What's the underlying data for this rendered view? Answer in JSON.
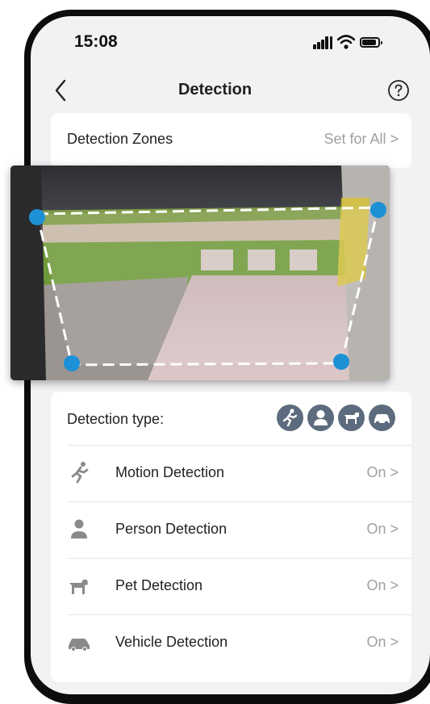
{
  "status_bar": {
    "time": "15:08"
  },
  "nav": {
    "title": "Detection"
  },
  "detection_zones": {
    "label": "Detection Zones",
    "link": "Set for All >"
  },
  "detection_type": {
    "label": "Detection type:",
    "rows": [
      {
        "label": "Motion Detection",
        "value": "On >",
        "icon": "running-person-icon"
      },
      {
        "label": "Person Detection",
        "value": "On >",
        "icon": "person-icon"
      },
      {
        "label": "Pet Detection",
        "value": "On >",
        "icon": "dog-icon"
      },
      {
        "label": "Vehicle Detection",
        "value": "On >",
        "icon": "car-icon"
      }
    ]
  },
  "colors": {
    "accent": "#1e90d6",
    "icon_badge": "#5d6b7e",
    "muted_text": "#a0a0a0"
  }
}
